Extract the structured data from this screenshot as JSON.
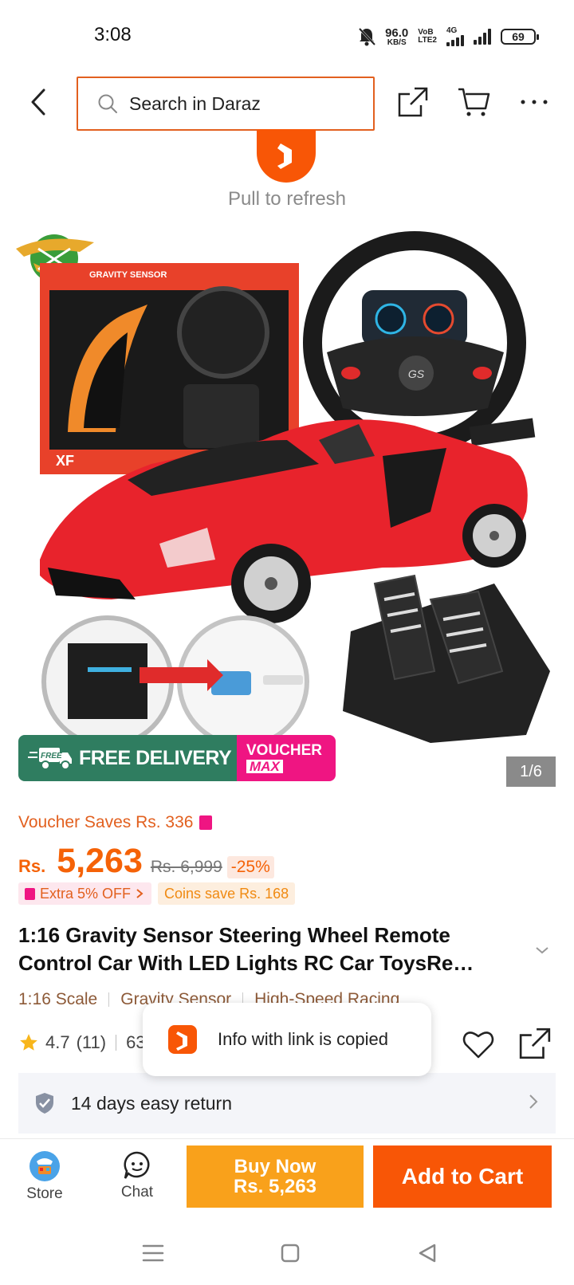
{
  "status_bar": {
    "time": "3:08",
    "net_speed_value": "96.0",
    "net_speed_unit": "KB/S",
    "volte_top": "VoB",
    "volte_bottom": "LTE2",
    "network": "4G",
    "battery": "69"
  },
  "header": {
    "search_placeholder": "Search in Daraz"
  },
  "refresh": {
    "label": "Pull to refresh"
  },
  "gallery": {
    "counter": "1/6",
    "box_label": "GRAVITY SENSOR",
    "box_brand": "XF",
    "wheel_badge": "GS",
    "banner_free_tag": "FREE",
    "banner_free_delivery": "FREE DELIVERY",
    "banner_voucher": "VOUCHER",
    "banner_max": "MAX"
  },
  "price": {
    "voucher_saves": "Voucher Saves Rs. 336",
    "currency": "Rs.",
    "current": "5,263",
    "original": "Rs. 6,999",
    "discount": "-25%",
    "extra_off": "Extra 5% OFF",
    "coins_save": "Coins save Rs. 168"
  },
  "product": {
    "title": "1:16 Gravity Sensor Steering Wheel Remote Control Car With LED Lights RC Car ToysRe…",
    "features": [
      "1:16 Scale",
      "Gravity Sensor",
      "High-Speed Racing"
    ],
    "rating": "4.7",
    "reviews": "(11)",
    "sold_partial": "63"
  },
  "toast": {
    "text": "Info with link is copied"
  },
  "return_policy": {
    "text": "14 days easy return"
  },
  "bottom_bar": {
    "store_label": "Store",
    "chat_label": "Chat",
    "buy_now_line1": "Buy Now",
    "buy_now_line2": "Rs. 5,263",
    "add_to_cart": "Add to Cart"
  },
  "colors": {
    "brand_orange": "#f85606",
    "buy_now": "#f9a11b",
    "voucher_pink": "#ef1582",
    "delivery_green": "#2f7d60"
  }
}
